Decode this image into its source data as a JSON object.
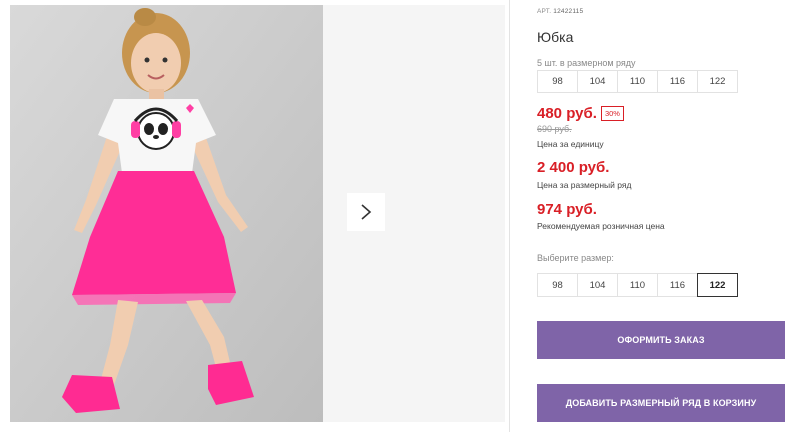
{
  "product": {
    "article_label": "АРТ.",
    "article_code": "12422115",
    "title": "Юбка",
    "count_note": "5 шт. в размерном ряду",
    "sizes": [
      "98",
      "104",
      "110",
      "116",
      "122"
    ]
  },
  "pricing": {
    "unit_price": "480 руб.",
    "discount": "30%",
    "old_price": "690 руб.",
    "unit_label": "Цена за единицу",
    "set_price": "2 400 руб.",
    "set_label": "Цена за размерный ряд",
    "retail_price": "974 руб.",
    "retail_label": "Рекомендуемая розничная цена"
  },
  "size_select": {
    "label": "Выберите размер:",
    "options": [
      "98",
      "104",
      "110",
      "116",
      "122"
    ],
    "selected": "122"
  },
  "actions": {
    "order_label": "ОФОРМИТЬ ЗАКАЗ",
    "add_set_label": "ДОБАВИТЬ РАЗМЕРНЫЙ РЯД В КОРЗИНУ"
  },
  "colors": {
    "accent_button": "#7f64a8",
    "price_red": "#d91f26"
  },
  "icons": {
    "next": "chevron-right-icon"
  }
}
